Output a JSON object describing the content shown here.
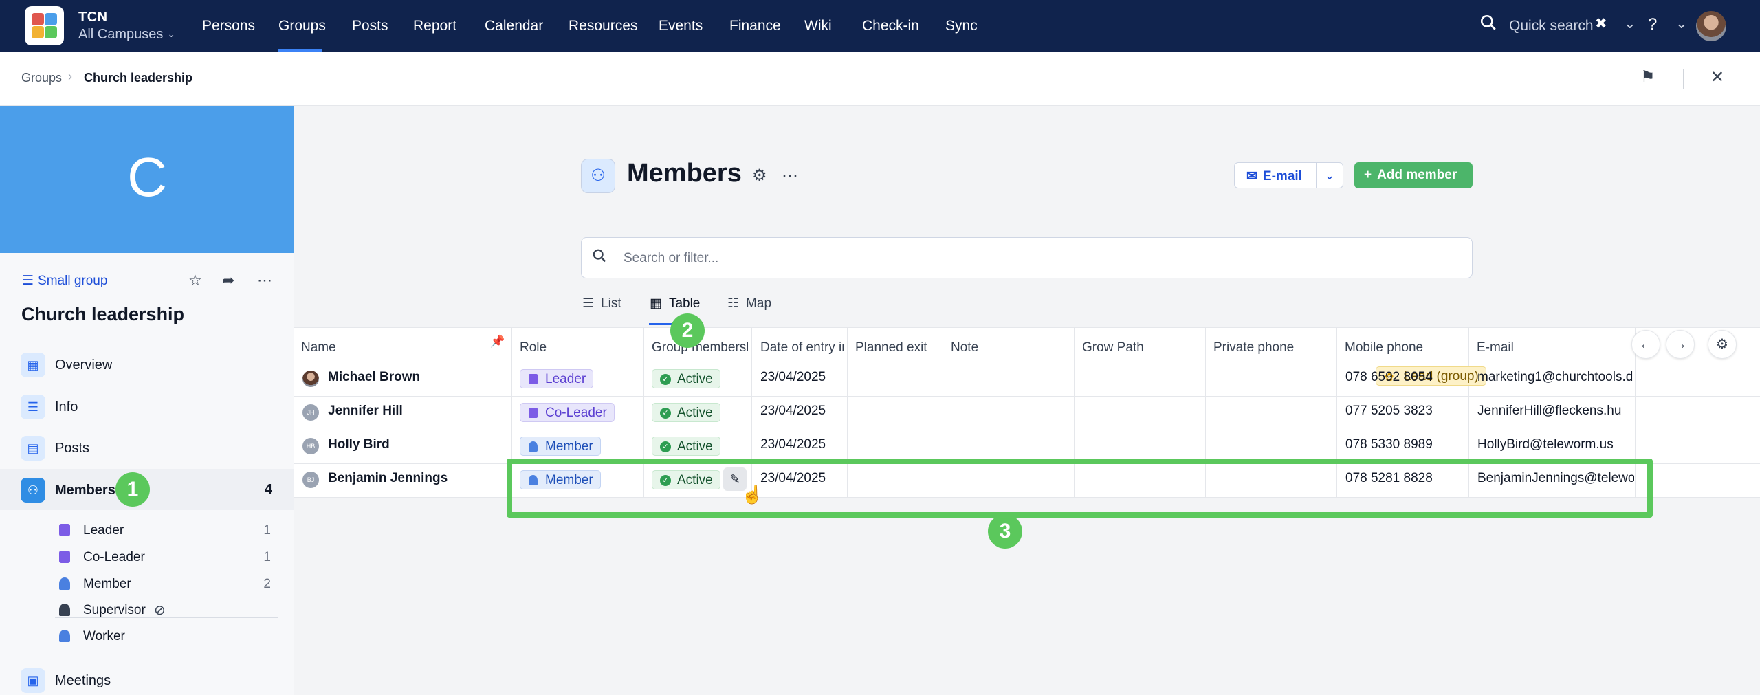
{
  "brand": {
    "name": "TCN",
    "campus": "All Campuses"
  },
  "nav": {
    "items": [
      "Persons",
      "Groups",
      "Posts",
      "Report",
      "Calendar",
      "Resources",
      "Events",
      "Finance",
      "Wiki",
      "Check-in",
      "Sync"
    ],
    "active": "Groups",
    "quick_search": "Quick search"
  },
  "breadcrumb": {
    "parent": "Groups",
    "current": "Church leadership"
  },
  "sidebar": {
    "hero_letter": "C",
    "group_type": "Small group",
    "group_name": "Church leadership",
    "items": [
      {
        "label": "Overview"
      },
      {
        "label": "Info"
      },
      {
        "label": "Posts"
      },
      {
        "label": "Members",
        "count": "4"
      },
      {
        "label": "Meetings"
      }
    ],
    "roles": [
      {
        "label": "Leader",
        "count": "1"
      },
      {
        "label": "Co-Leader",
        "count": "1"
      },
      {
        "label": "Member",
        "count": "2"
      },
      {
        "label": "Supervisor",
        "count": ""
      },
      {
        "label": "Worker",
        "count": ""
      }
    ]
  },
  "main": {
    "title": "Members",
    "email_label": "E-mail",
    "add_member_label": "Add member",
    "search_placeholder": "Search or filter...",
    "views": [
      "List",
      "Table",
      "Map"
    ],
    "active_view": "Table"
  },
  "table": {
    "columns": [
      "Name",
      "Role",
      "Group membersh",
      "Date of entry in",
      "Planned exit",
      "Note",
      "Grow Path",
      "Private phone",
      "Mobile phone",
      "E-mail"
    ],
    "rows": [
      {
        "initials": "",
        "name": "Michael Brown",
        "role": "Leader",
        "status": "Active",
        "date": "23/04/2025",
        "grow": "Lead (group)",
        "mobile": "078 6592 8054",
        "email": "marketing1@churchtools.d"
      },
      {
        "initials": "JH",
        "name": "Jennifer Hill",
        "role": "Co-Leader",
        "status": "Active",
        "date": "23/04/2025",
        "grow": "",
        "mobile": "077 5205 3823",
        "email": "JenniferHill@fleckens.hu"
      },
      {
        "initials": "HB",
        "name": "Holly Bird",
        "role": "Member",
        "status": "Active",
        "date": "23/04/2025",
        "grow": "",
        "mobile": "078 5330 8989",
        "email": "HollyBird@teleworm.us"
      },
      {
        "initials": "BJ",
        "name": "Benjamin Jennings",
        "role": "Member",
        "status": "Active",
        "date": "23/04/2025",
        "grow": "",
        "mobile": "078 5281 8828",
        "email": "BenjaminJennings@telewo"
      }
    ]
  },
  "annotations": {
    "step1": "1",
    "step2": "2",
    "step3": "3"
  },
  "colors": {
    "nav_bg": "#10234d",
    "hero": "#4b9eea",
    "accent": "#2563eb",
    "add_button": "#4cb56a",
    "highlight": "#5bc85c"
  }
}
